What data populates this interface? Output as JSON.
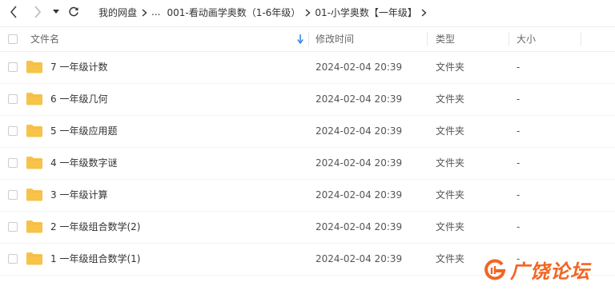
{
  "nav": {
    "back_icon": "chevron-left-icon",
    "forward_icon": "chevron-right-icon",
    "history_icon": "caret-down-icon",
    "refresh_icon": "refresh-icon"
  },
  "breadcrumb": [
    {
      "label": "我的网盘"
    },
    {
      "label": "..."
    },
    {
      "label": "001-看动画学奥数（1-6年级）"
    },
    {
      "label": "01-小学奥数【一年级】"
    }
  ],
  "table": {
    "columns": {
      "name": "文件名",
      "modified": "修改时间",
      "type": "类型",
      "size": "大小"
    },
    "sort_icon": "sort-down-arrow-icon",
    "rows": [
      {
        "name": "7 一年级计数",
        "modified": "2024-02-04 20:39",
        "type": "文件夹",
        "size": "-"
      },
      {
        "name": "6 一年级几何",
        "modified": "2024-02-04 20:39",
        "type": "文件夹",
        "size": "-"
      },
      {
        "name": "5 一年级应用题",
        "modified": "2024-02-04 20:39",
        "type": "文件夹",
        "size": "-"
      },
      {
        "name": "4 一年级数字谜",
        "modified": "2024-02-04 20:39",
        "type": "文件夹",
        "size": "-"
      },
      {
        "name": "3 一年级计算",
        "modified": "2024-02-04 20:39",
        "type": "文件夹",
        "size": "-"
      },
      {
        "name": "2 一年级组合数学(2)",
        "modified": "2024-02-04 20:39",
        "type": "文件夹",
        "size": "-"
      },
      {
        "name": "1 一年级组合数学(1)",
        "modified": "2024-02-04 20:39",
        "type": "文件夹",
        "size": "-"
      }
    ]
  },
  "watermark": {
    "text": "广饶论坛",
    "color": "#f26522"
  },
  "colors": {
    "folder": "#f8c34a",
    "folder_dark": "#f0b43a",
    "sort_arrow": "#2f7de1"
  }
}
